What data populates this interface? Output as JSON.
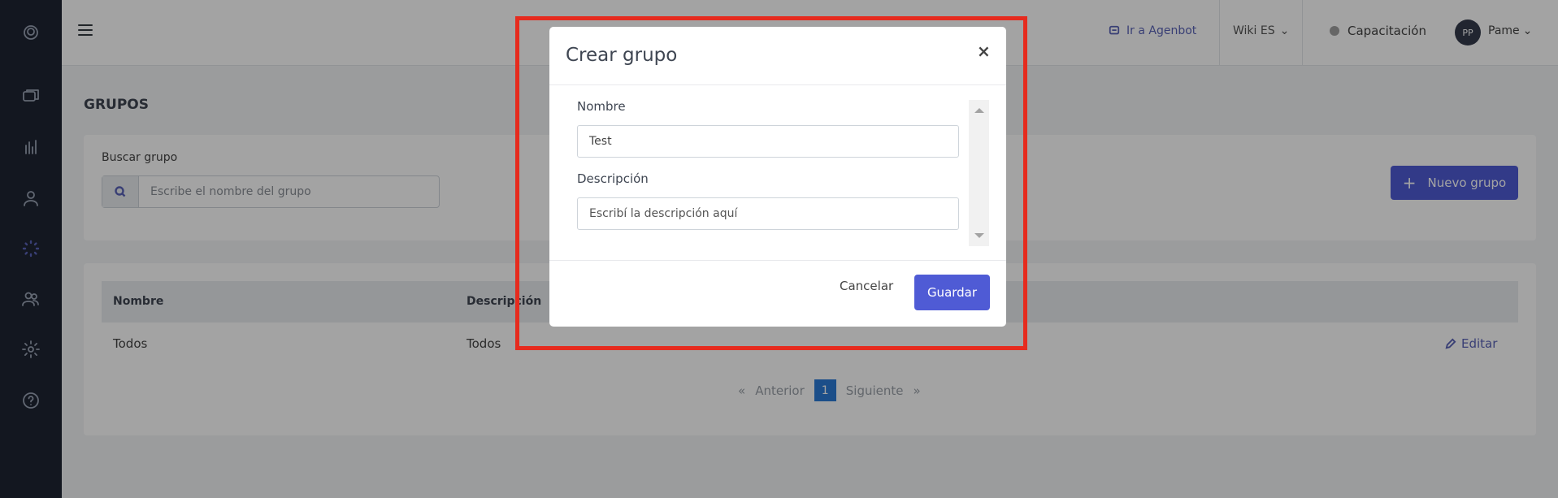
{
  "sidebar": {
    "items": [
      {
        "icon": "logo-icon"
      },
      {
        "icon": "chat-icon"
      },
      {
        "icon": "stats-icon"
      },
      {
        "icon": "user-icon"
      },
      {
        "icon": "loader-icon"
      },
      {
        "icon": "users-icon"
      },
      {
        "icon": "settings-icon"
      },
      {
        "icon": "help-icon"
      }
    ]
  },
  "topbar": {
    "agenbot_link": "Ir a Agenbot",
    "wiki_label": "Wiki ES",
    "status_label": "Capacitación",
    "avatar_initials": "PP",
    "user_name": "Pame"
  },
  "page": {
    "title": "GRUPOS",
    "search_label": "Buscar grupo",
    "search_placeholder": "Escribe el nombre del grupo",
    "new_button": "Nuevo grupo",
    "table": {
      "columns": [
        "Nombre",
        "Descripción"
      ],
      "rows": [
        {
          "nombre": "Todos",
          "descripcion": "Todos",
          "edit": "Editar"
        }
      ]
    },
    "pagination": {
      "prev_arrow": "«",
      "prev": "Anterior",
      "current": "1",
      "next": "Siguiente",
      "next_arrow": "»"
    }
  },
  "modal": {
    "title": "Crear grupo",
    "close": "×",
    "name_label": "Nombre",
    "name_value": "Test",
    "desc_label": "Descripción",
    "desc_placeholder": "Escribí la descripción aquí",
    "cancel": "Cancelar",
    "save": "Guardar"
  },
  "colors": {
    "primary": "#4f5bd5",
    "sidebar": "#1e2533",
    "highlight": "#e62b1e"
  }
}
